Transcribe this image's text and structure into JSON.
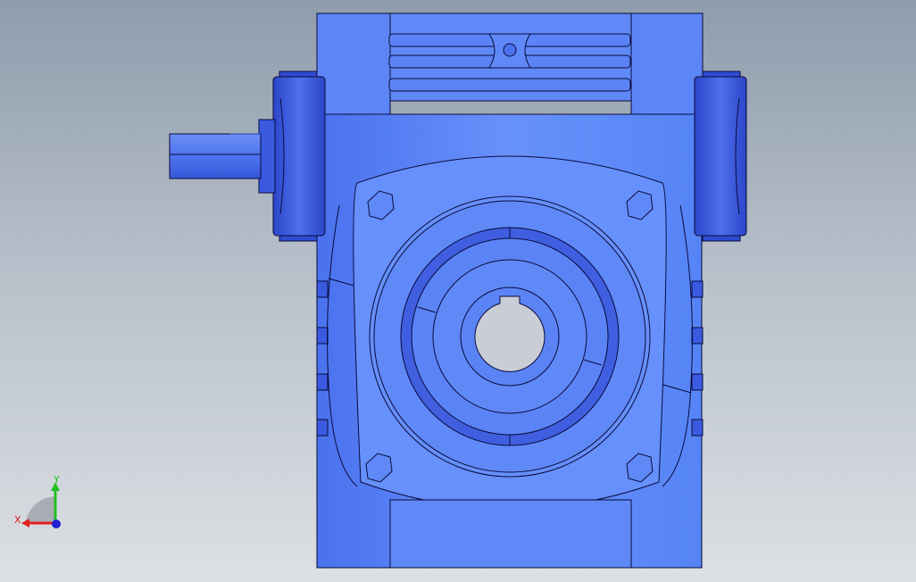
{
  "viewport": {
    "background_top": "#8f9cac",
    "background_bottom": "#dde0e4"
  },
  "model": {
    "description": "worm-gear-reducer-front-view",
    "body_color": "#5f8cf8",
    "body_dark_color": "#3f5fe0",
    "edge_color": "#0a0a3c"
  },
  "triad": {
    "x_label": "X",
    "y_label": "Y",
    "x_color": "#e02020",
    "y_color": "#20c020",
    "z_color": "#2020d0"
  }
}
